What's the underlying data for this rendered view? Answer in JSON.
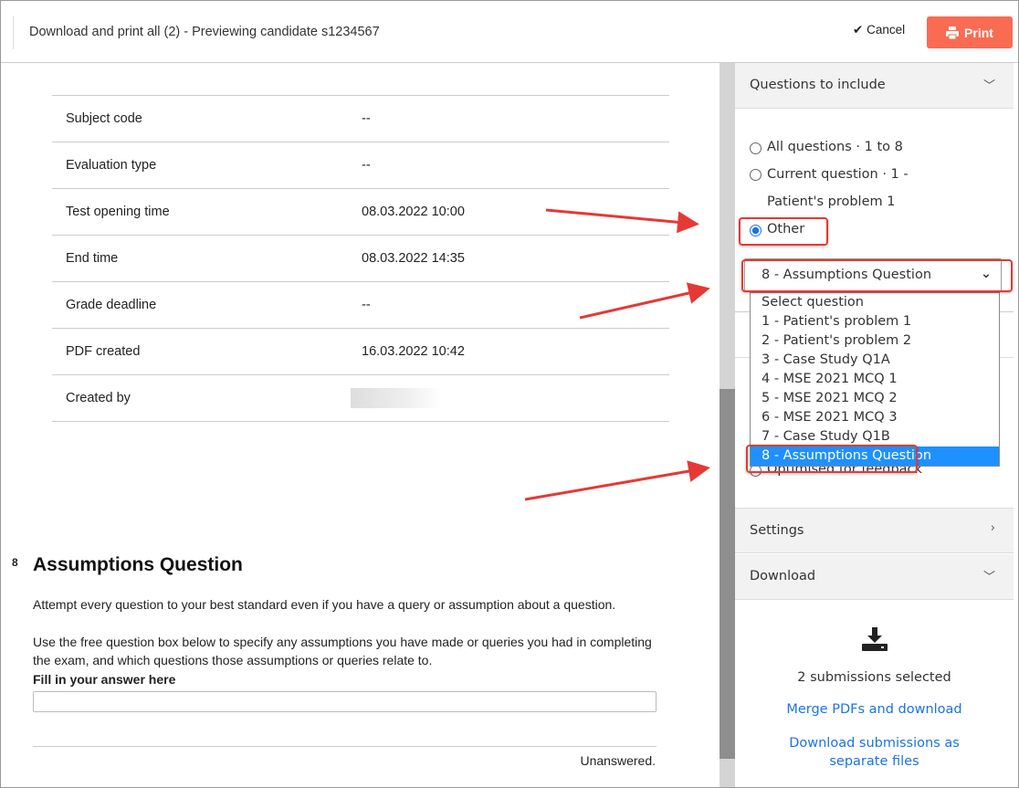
{
  "header": {
    "title": "Download and print all (2) - Previewing candidate s1234567",
    "cancel": "Cancel",
    "print": "Print"
  },
  "details": [
    {
      "label": "Subject code",
      "value": "--"
    },
    {
      "label": "Evaluation type",
      "value": "--"
    },
    {
      "label": "Test opening time",
      "value": "08.03.2022 10:00"
    },
    {
      "label": "End time",
      "value": "08.03.2022 14:35"
    },
    {
      "label": "Grade deadline",
      "value": "--"
    },
    {
      "label": "PDF created",
      "value": "16.03.2022 10:42"
    },
    {
      "label": "Created by",
      "value": null
    }
  ],
  "question": {
    "number": "8",
    "title": "Assumptions Question",
    "p1": "Attempt every question to your best standard even if you have a query or assumption about a question.",
    "p2": "Use the free question box below to specify any assumptions you have made or queries you had in completing the exam, and which questions those assumptions or queries relate to.",
    "answer_label": "Fill in your answer here",
    "answer_value": "",
    "status": "Unanswered."
  },
  "panel": {
    "questions_header": "Questions to include",
    "radios": [
      {
        "label": "All questions · 1 to 8",
        "checked": false
      },
      {
        "label": "Current question · 1 - Patient's problem 1",
        "checked": false
      },
      {
        "label": "Other",
        "checked": true
      }
    ],
    "select_value": "8 - Assumptions Question",
    "options": [
      "Select question",
      "1 - Patient's problem 1",
      "2 - Patient's problem 2",
      "3 - Case Study Q1A",
      "4 - MSE 2021 MCQ 1",
      "5 - MSE 2021 MCQ 2",
      "6 - MSE 2021 MCQ 3",
      "7 - Case Study Q1B",
      "8 - Assumptions Question"
    ],
    "hidden_radio": "Optimised for feedback",
    "settings": "Settings",
    "download": "Download",
    "selected_count": "2 submissions selected",
    "merge_link": "Merge PDFs and download",
    "separate_link": "Download submissions as separate files"
  },
  "colors": {
    "accent": "#f96b52",
    "link": "#1a73e8",
    "highlight": "#e53935",
    "selected_option": "#1e90ff"
  }
}
